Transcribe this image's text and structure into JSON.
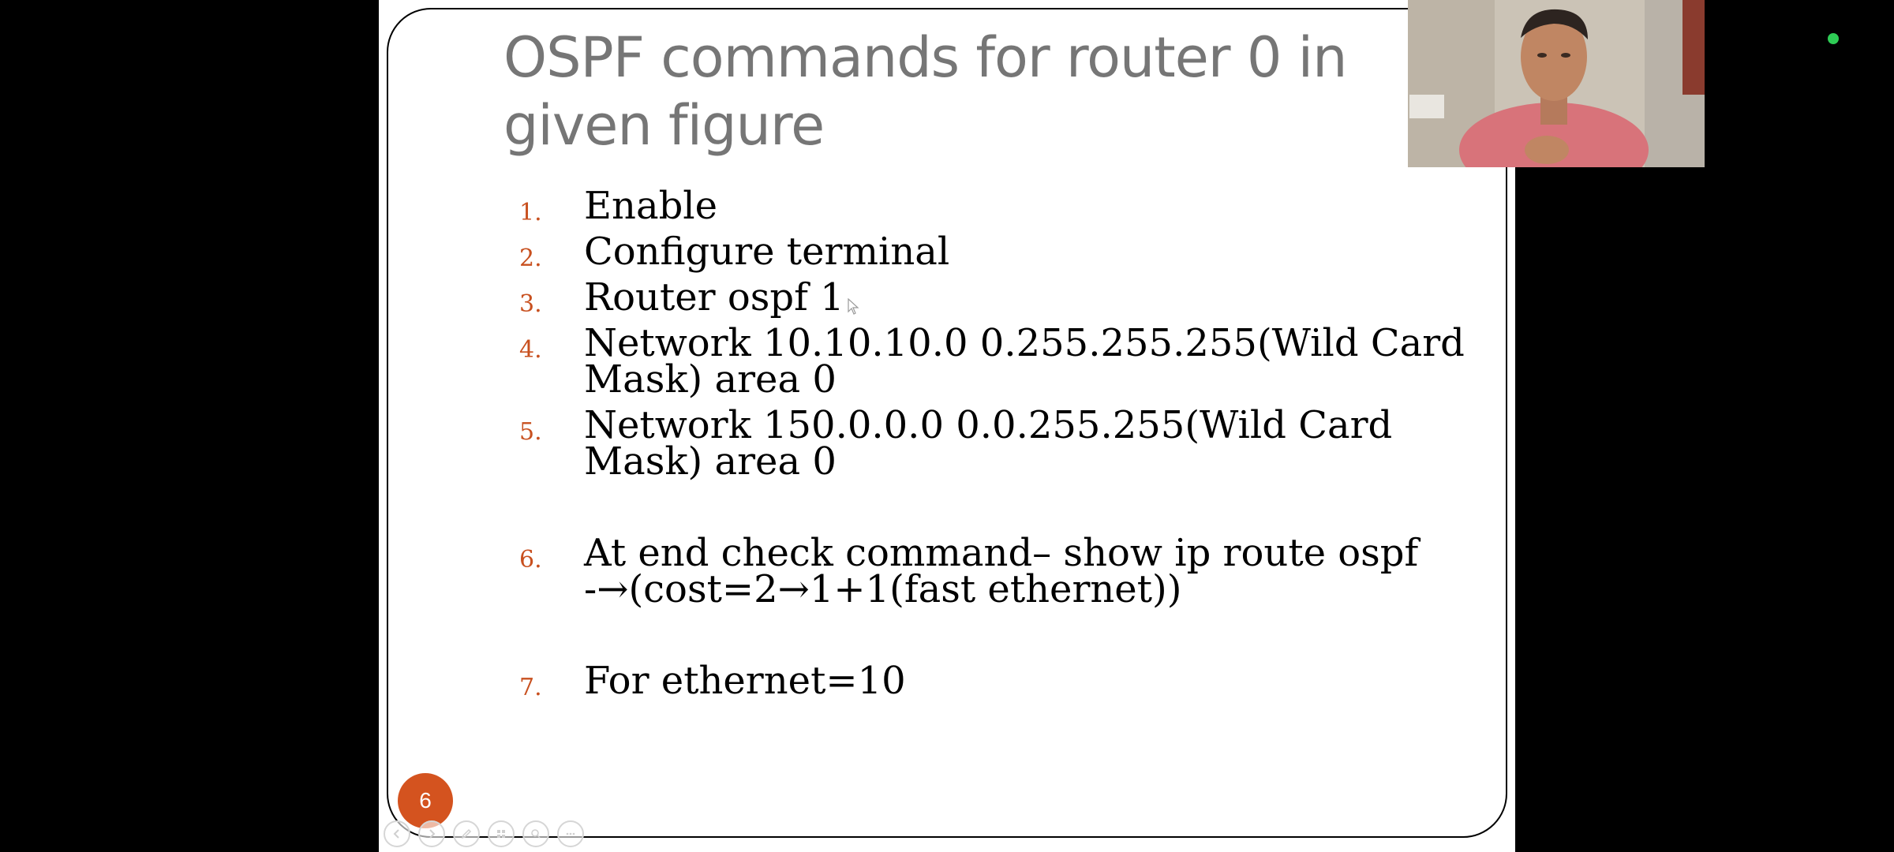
{
  "slide": {
    "title": "OSPF commands for router 0 in given figure",
    "page_number": "6",
    "commands": [
      {
        "num": "1.",
        "text": "Enable"
      },
      {
        "num": "2.",
        "text": "Configure terminal"
      },
      {
        "num": "3.",
        "text": "Router ospf 1"
      },
      {
        "num": "4.",
        "text": "Network 10.10.10.0 0.255.255.255(Wild Card\nMask) area 0"
      },
      {
        "num": "5.",
        "text": "Network 150.0.0.0 0.0.255.255(Wild Card\nMask) area 0"
      },
      {
        "num": "6.",
        "text": "At end check command– show ip route ospf\n-→(cost=2→1+1(fast ethernet))"
      },
      {
        "num": "7.",
        "text": "For ethernet=10"
      }
    ]
  },
  "toolbar": {
    "buttons": [
      "prev-icon",
      "next-icon",
      "pen-icon",
      "slides-icon",
      "zoom-icon",
      "more-icon"
    ]
  },
  "colors": {
    "accent": "#D4531F",
    "title_gray": "#767676",
    "list_number": "#C8501F",
    "status_online": "#2ecc55"
  }
}
